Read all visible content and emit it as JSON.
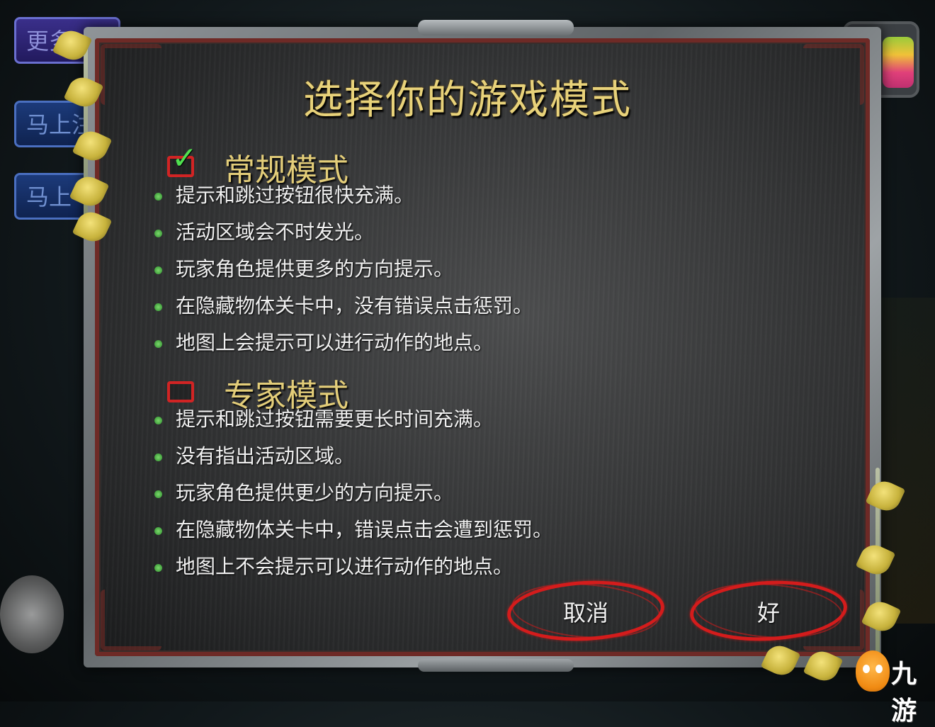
{
  "background": {
    "left_buttons": [
      {
        "label": "更多"
      },
      {
        "label": "马上注"
      },
      {
        "label": "马上"
      }
    ]
  },
  "dialog": {
    "title": "选择你的游戏模式",
    "modes": [
      {
        "label": "常规模式",
        "checked": true,
        "bullets": [
          "提示和跳过按钮很快充满。",
          "活动区域会不时发光。",
          "玩家角色提供更多的方向提示。",
          "在隐藏物体关卡中，没有错误点击惩罚。",
          "地图上会提示可以进行动作的地点。"
        ]
      },
      {
        "label": "专家模式",
        "checked": false,
        "bullets": [
          "提示和跳过按钮需要更长时间充满。",
          "没有指出活动区域。",
          "玩家角色提供更少的方向提示。",
          "在隐藏物体关卡中，错误点击会遭到惩罚。",
          "地图上不会提示可以进行动作的地点。"
        ]
      }
    ],
    "buttons": {
      "cancel": "取消",
      "ok": "好"
    }
  },
  "watermark": {
    "text": "九游"
  },
  "colors": {
    "title_gold": "#e8d27a",
    "checkbox_red": "#d12424",
    "checkmark_green": "#4fe04f",
    "button_ring_red": "#d41c1c",
    "bullet_green": "#2e8c2e"
  }
}
